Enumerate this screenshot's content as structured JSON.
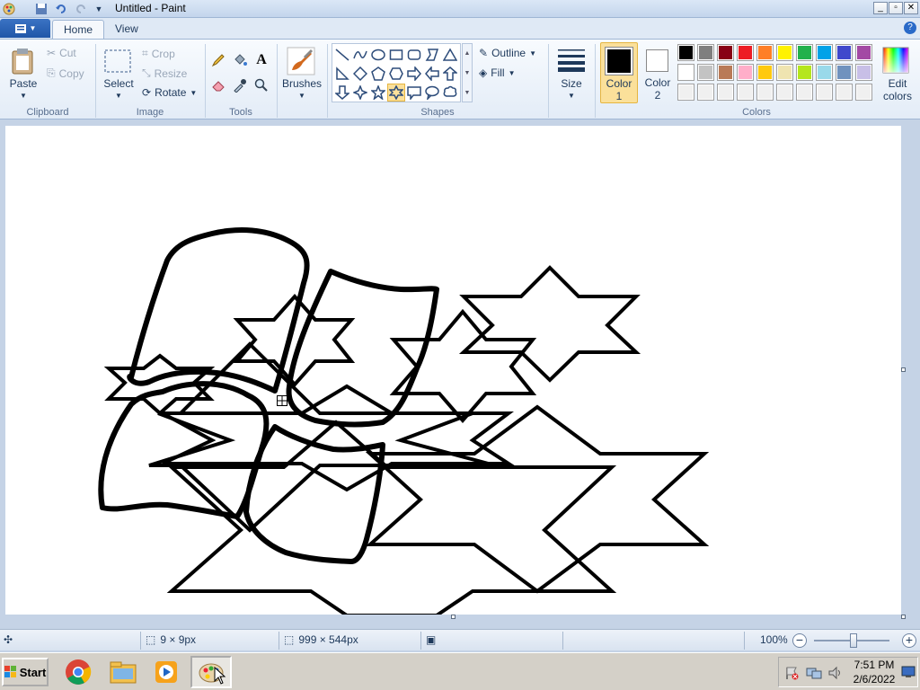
{
  "window": {
    "title": "Untitled - Paint",
    "min_label": "_",
    "max_label": "▫",
    "close_label": "✕"
  },
  "tabs": [
    {
      "label": "Home",
      "active": true
    },
    {
      "label": "View",
      "active": false
    }
  ],
  "ribbon": {
    "clipboard": {
      "group": "Clipboard",
      "paste": "Paste",
      "cut": "Cut",
      "copy": "Copy"
    },
    "image": {
      "group": "Image",
      "select": "Select",
      "crop": "Crop",
      "resize": "Resize",
      "rotate": "Rotate"
    },
    "tools": {
      "group": "Tools"
    },
    "brushes": {
      "label": "Brushes"
    },
    "shapes": {
      "group": "Shapes",
      "outline": "Outline",
      "fill": "Fill"
    },
    "size": {
      "label": "Size"
    },
    "color1": {
      "label": "Color",
      "sub": "1",
      "value": "#000000"
    },
    "color2": {
      "label": "Color",
      "sub": "2",
      "value": "#ffffff"
    },
    "colors": {
      "group": "Colors",
      "edit": "Edit",
      "edit_sub": "colors"
    }
  },
  "palette": [
    "#000000",
    "#7f7f7f",
    "#880015",
    "#ed1c24",
    "#ff7f27",
    "#fff200",
    "#22b14c",
    "#00a2e8",
    "#3f48cc",
    "#a349a4",
    "#ffffff",
    "#c3c3c3",
    "#b97a57",
    "#ffaec9",
    "#ffc90e",
    "#efe4b0",
    "#b5e61d",
    "#99d9ea",
    "#7092be",
    "#c8bfe7",
    "#f0f0f0",
    "#f0f0f0",
    "#f0f0f0",
    "#f0f0f0",
    "#f0f0f0",
    "#f0f0f0",
    "#f0f0f0",
    "#f0f0f0",
    "#f0f0f0",
    "#f0f0f0"
  ],
  "status": {
    "selection_size": "9 × 9px",
    "canvas_size": "999 × 544px",
    "zoom": "100%"
  },
  "taskbar": {
    "start": "Start",
    "time": "7:51 PM",
    "date": "2/6/2022"
  }
}
